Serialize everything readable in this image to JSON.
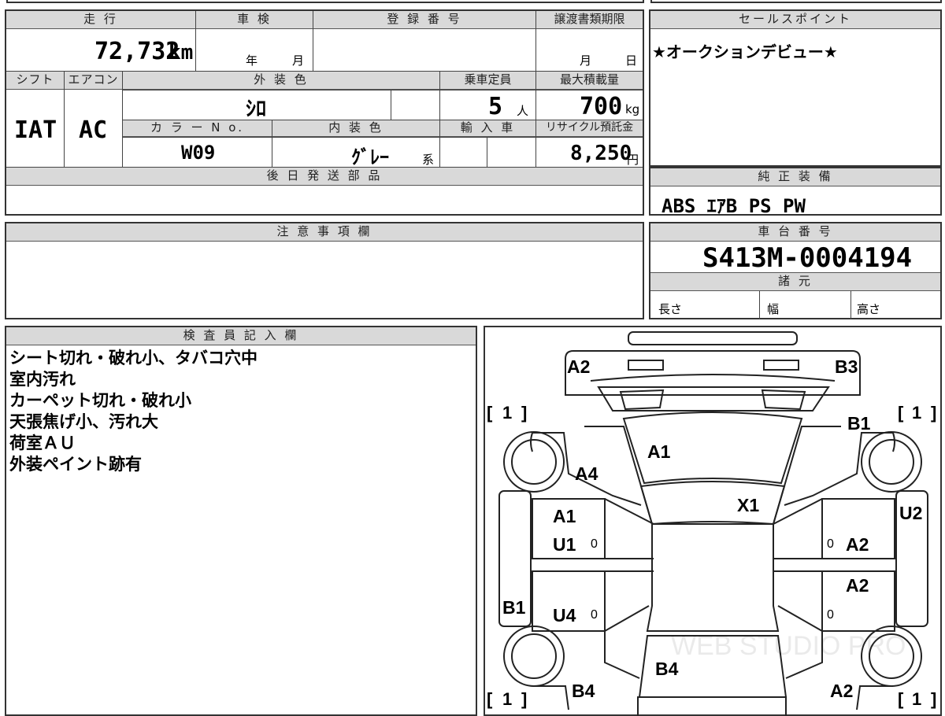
{
  "top_table": {
    "mileage_header": "走 行",
    "mileage_value": "72,732",
    "mileage_unit": "km",
    "inspection_header": "車 検",
    "inspection_year": "年",
    "inspection_month": "月",
    "registration_header": "登 録 番 号",
    "transfer_header": "譲渡書類期限",
    "transfer_month": "月",
    "transfer_day": "日",
    "shift_header": "シフト",
    "ac_header": "エアコン",
    "exterior_color_header": "外 装 色",
    "capacity_header": "乗車定員",
    "max_load_header": "最大積載量",
    "shift_value": "IAT",
    "ac_value": "AC",
    "exterior_color_value": "ｼﾛ",
    "capacity_value": "5",
    "capacity_unit": "人",
    "max_load_value": "700",
    "max_load_unit": "kg",
    "color_no_header": "カ ラ ー N o.",
    "interior_color_header": "内 装 色",
    "import_header": "輸 入 車",
    "recycle_header": "リサイクル預託金",
    "color_no_value": "W09",
    "interior_color_value": "ｸﾞﾚｰ",
    "interior_color_suffix": "系",
    "recycle_value": "8,250",
    "recycle_unit": "円",
    "later_parts_header": "後 日 発 送 部 品"
  },
  "sales_point": {
    "header": "セールスポイント",
    "text": "★オークションデビュー★"
  },
  "equipment": {
    "header": "純 正 装 備",
    "items": "ABS ｴｱB PS PW"
  },
  "notes": {
    "header": "注 意 事 項 欄"
  },
  "chassis": {
    "header": "車 台 番 号",
    "value": "S413M-0004194",
    "specs_header": "諸 元",
    "length_label": "長さ",
    "width_label": "幅",
    "height_label": "高さ"
  },
  "inspector": {
    "header": "検 査 員 記 入 欄",
    "lines": [
      "シート切れ・破れ小、タバコ穴中",
      "室内汚れ",
      "カーペット切れ・破れ小",
      "天張焦げ小、汚れ大",
      "荷室ＡＵ",
      "外装ペイント跡有"
    ]
  },
  "diagram": {
    "codes": {
      "front_left": "A2",
      "front_right": "B3",
      "fender_right": "B1",
      "windshield": "A1",
      "fender_left": "A4",
      "roof": "X1",
      "front_door_left_1": "A1",
      "front_door_left_2": "U1",
      "rear_door_left": "U4",
      "sill_left": "B1",
      "front_door_right": "A2",
      "rear_door_right": "A2",
      "sill_right": "U2",
      "tailgate": "B4",
      "rear_fender_left": "B4",
      "rear_fender_right": "A2"
    },
    "tire_bracket_value": "1",
    "door_zero_marks": "0",
    "watermark": "WEB STUDIO PRO"
  }
}
